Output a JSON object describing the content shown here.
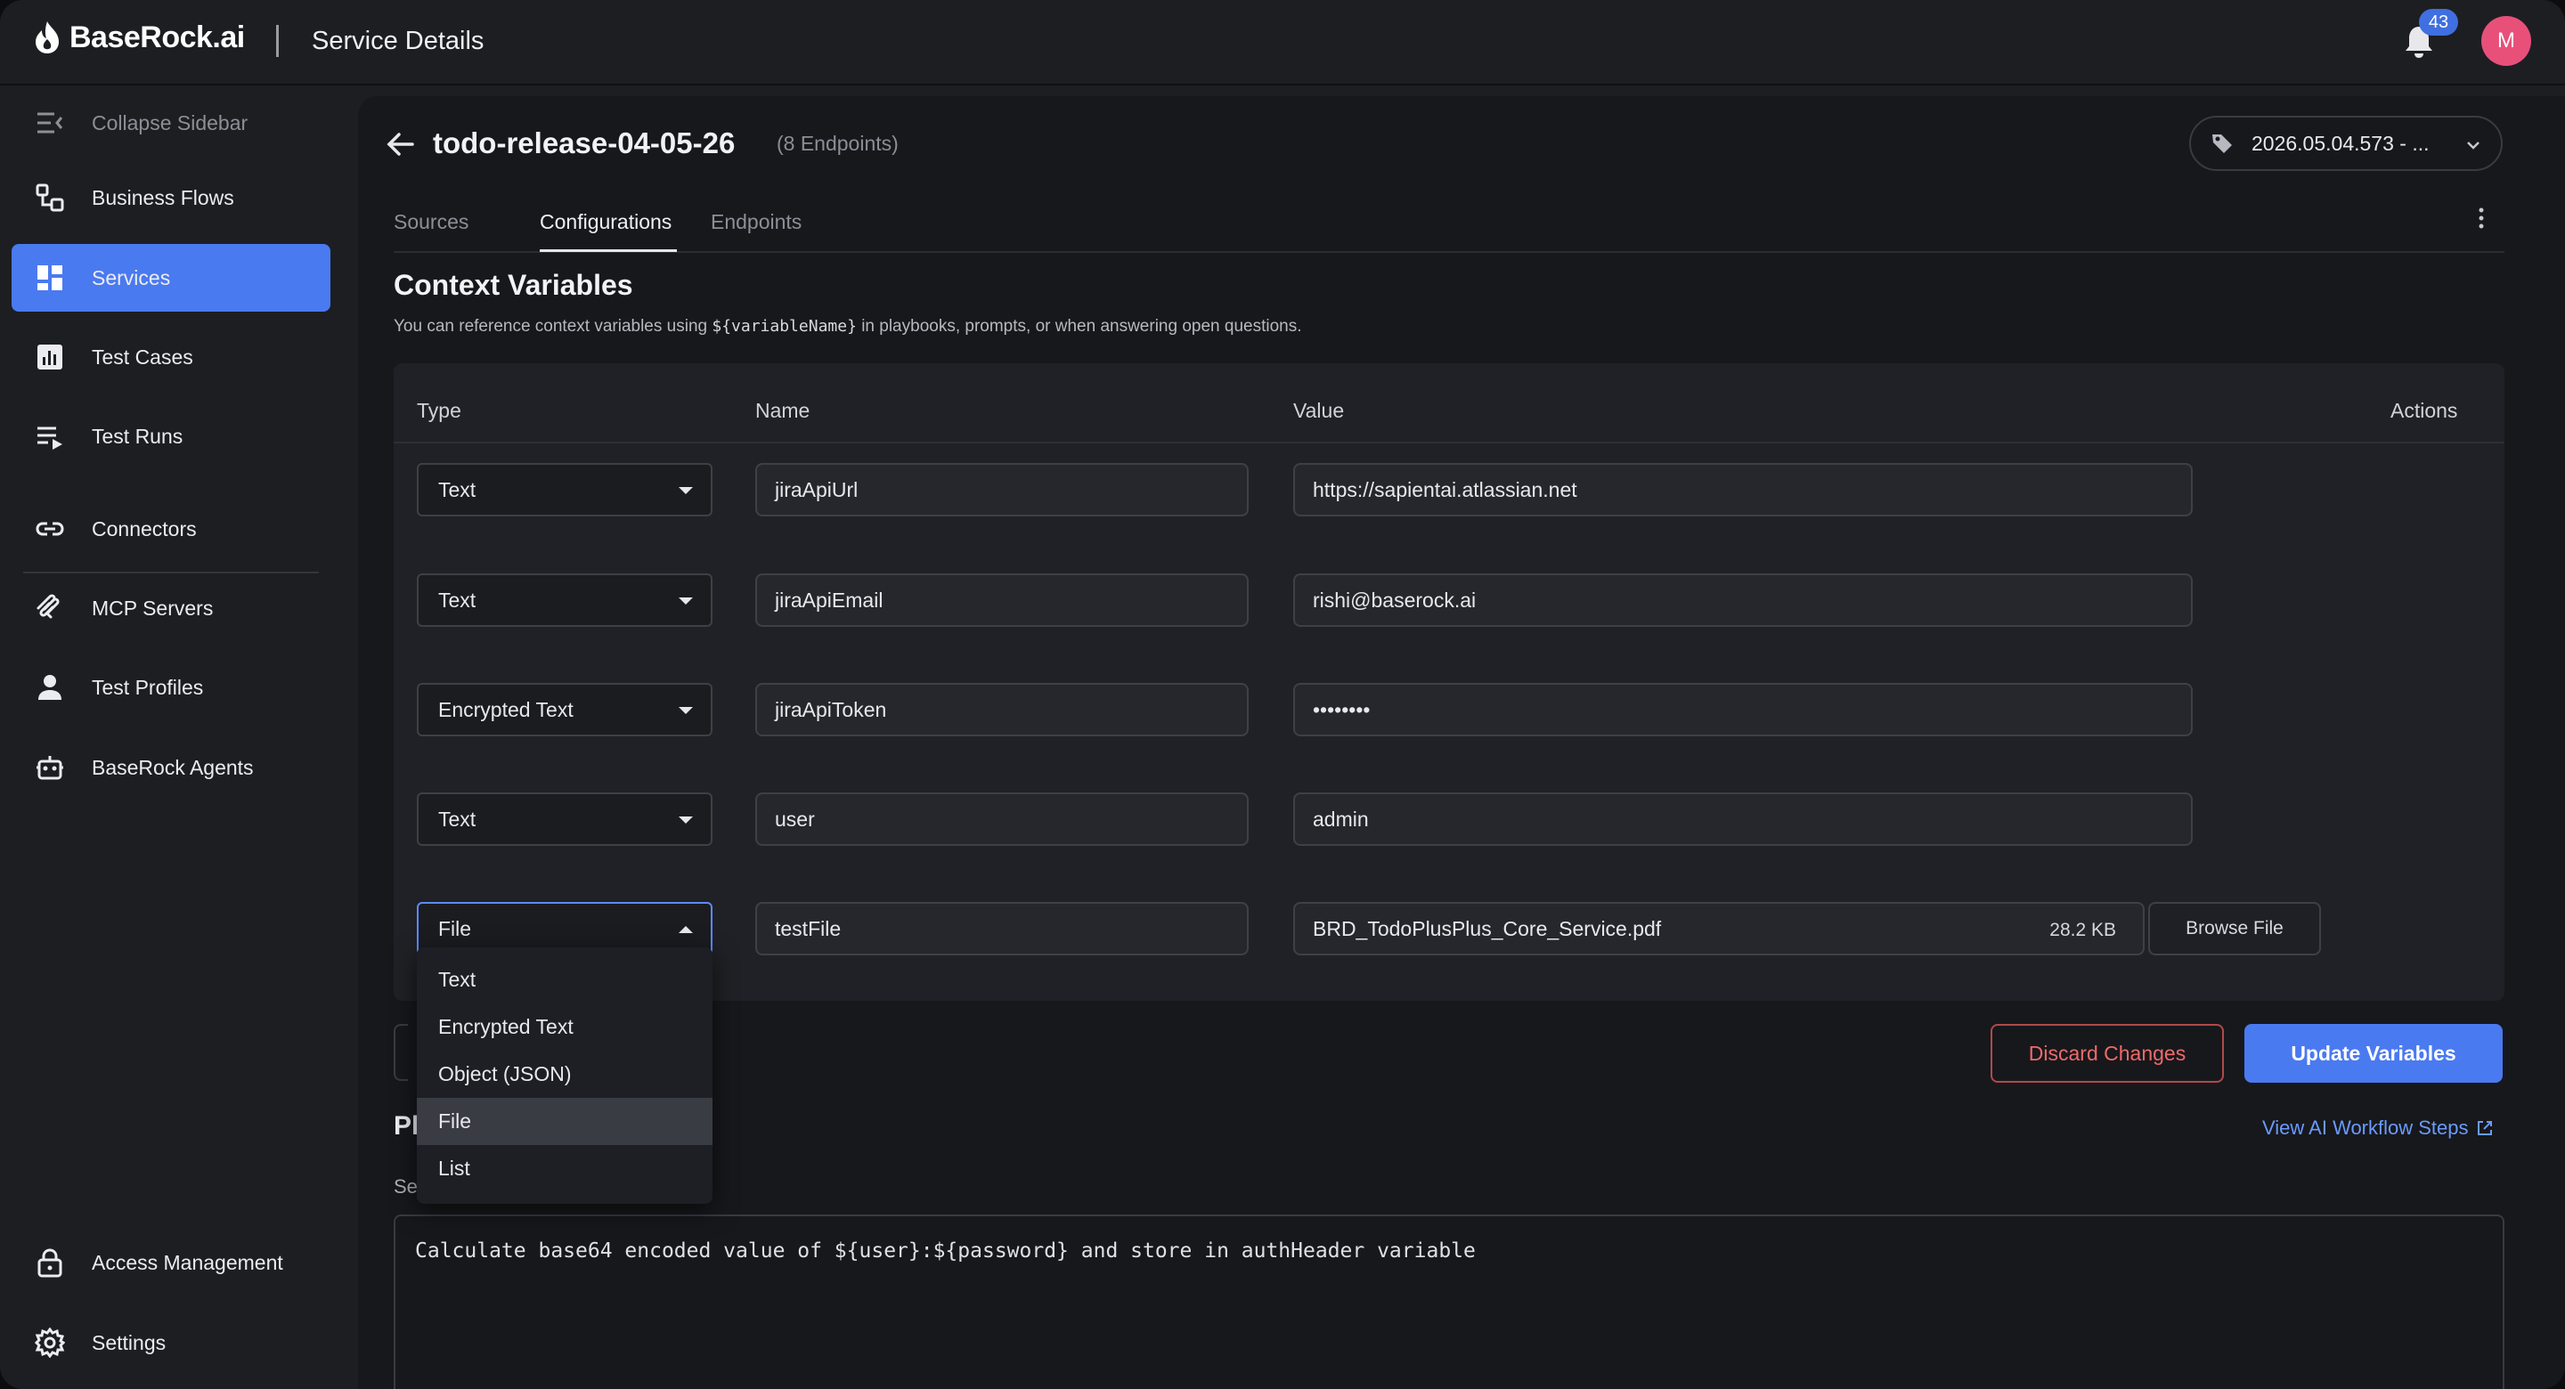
{
  "app": {
    "logo_text": "BaseRock.ai",
    "page_heading": "Service Details",
    "notifications_count": "43",
    "avatar_initial": "M"
  },
  "sidebar": {
    "collapse_label": "Collapse Sidebar",
    "items": [
      {
        "label": "Business Flows",
        "icon": "business-flows-icon"
      },
      {
        "label": "Services",
        "icon": "services-grid-icon",
        "active": true
      },
      {
        "label": "Test Cases",
        "icon": "chart-icon"
      },
      {
        "label": "Test Runs",
        "icon": "play-list-icon"
      },
      {
        "label": "Connectors",
        "icon": "link-icon"
      },
      {
        "label": "MCP Servers",
        "icon": "mcp-icon"
      },
      {
        "label": "Test Profiles",
        "icon": "user-icon"
      },
      {
        "label": "BaseRock Agents",
        "icon": "robot-icon"
      }
    ],
    "bottom_items": [
      {
        "label": "Access Management",
        "icon": "lock-icon"
      },
      {
        "label": "Settings",
        "icon": "gear-icon"
      }
    ],
    "active_color": "#4a7af0"
  },
  "service": {
    "title": "todo-release-04-05-26",
    "endpoint_count": "(8 Endpoints)",
    "version": "2026.05.04.573 - ..."
  },
  "tabs": [
    {
      "label": "Sources"
    },
    {
      "label": "Configurations",
      "active": true
    },
    {
      "label": "Endpoints"
    }
  ],
  "context": {
    "title": "Context Variables",
    "desc_before": "You can reference context variables using ",
    "desc_code": "${variableName}",
    "desc_after": " in playbooks, prompts, or when answering open questions."
  },
  "table": {
    "headers": {
      "type": "Type",
      "name": "Name",
      "value": "Value",
      "actions": "Actions"
    },
    "rows": [
      {
        "type": "Text",
        "name": "jiraApiUrl",
        "value": "https://sapientai.atlassian.net"
      },
      {
        "type": "Text",
        "name": "jiraApiEmail",
        "value": "rishi@baserock.ai"
      },
      {
        "type": "Encrypted Text",
        "name": "jiraApiToken",
        "value": "••••••••"
      },
      {
        "type": "Text",
        "name": "user",
        "value": "admin"
      },
      {
        "type": "File",
        "name": "testFile",
        "value": "BRD_TodoPlusPlus_Core_Service.pdf",
        "file_size": "28.2 KB"
      }
    ],
    "browse_label": "Browse File"
  },
  "type_dropdown": {
    "options": [
      "Text",
      "Encrypted Text",
      "Object (JSON)",
      "File",
      "List"
    ],
    "selected": "File"
  },
  "actions": {
    "discard": "Discard Changes",
    "update": "Update Variables",
    "workflow_link": "View AI Workflow Steps"
  },
  "playbook": {
    "heading_partial": "Pl",
    "sub_partial": "Se",
    "prompt": "Calculate base64 encoded value of ${user}:${password} and store in authHeader variable"
  }
}
